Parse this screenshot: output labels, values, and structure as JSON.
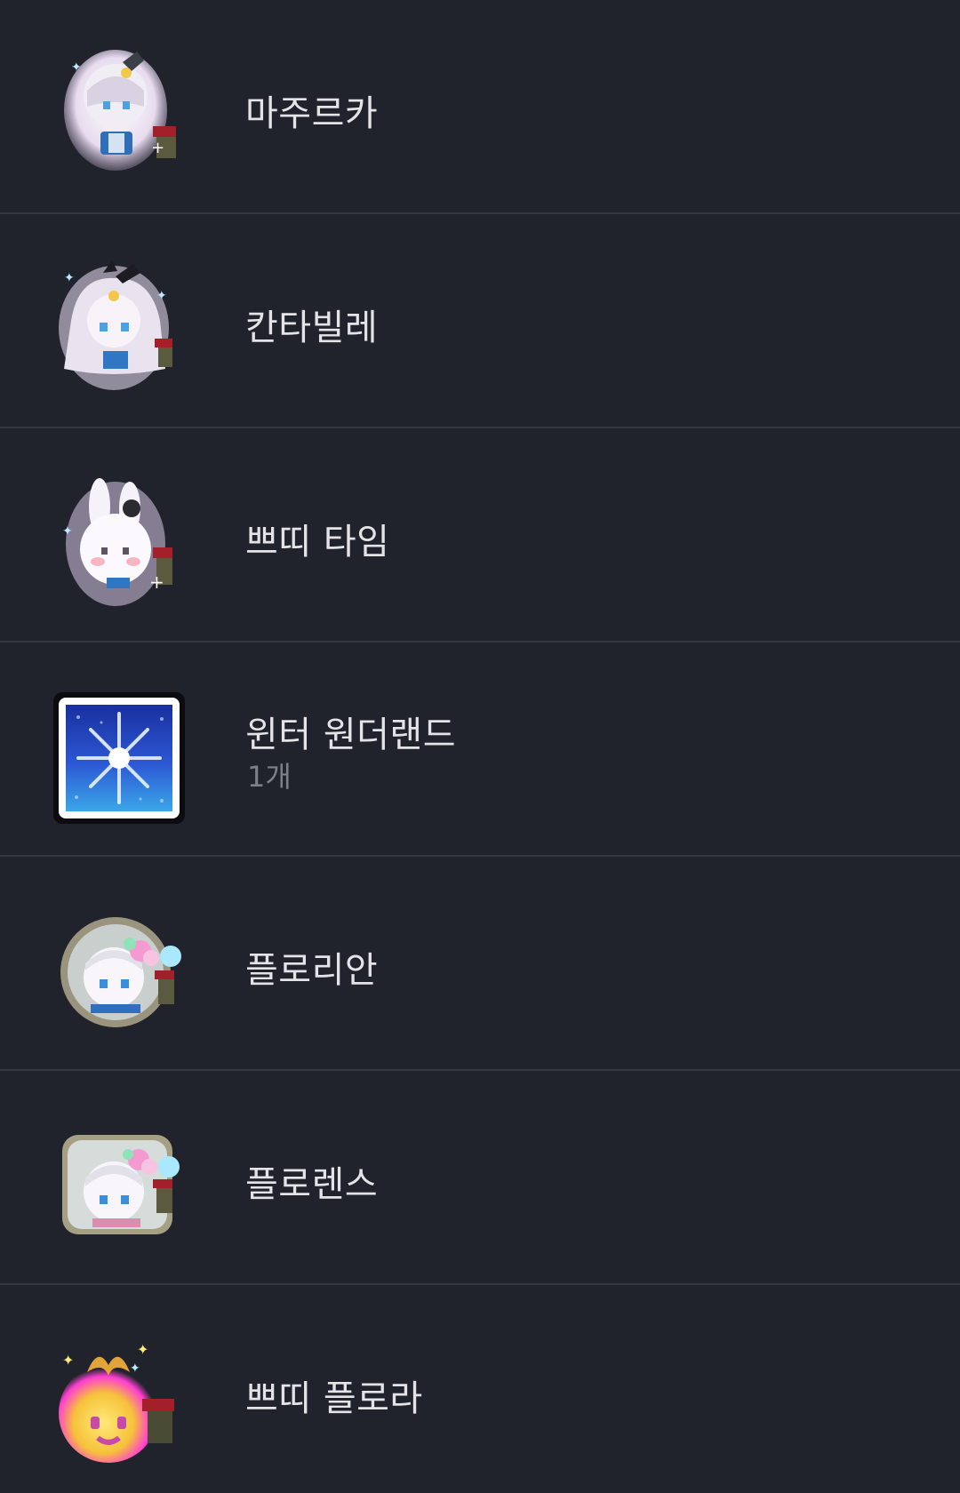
{
  "items": [
    {
      "name": "마주르카",
      "count": "",
      "icon": "chibi-character-icon"
    },
    {
      "name": "칸타빌레",
      "count": "",
      "icon": "chibi-character-icon"
    },
    {
      "name": "쁘띠 타임",
      "count": "",
      "icon": "bunny-character-icon"
    },
    {
      "name": "윈터 원더랜드",
      "count": "1개",
      "icon": "snowflake-tile-icon"
    },
    {
      "name": "플로리안",
      "count": "",
      "icon": "flower-chibi-icon"
    },
    {
      "name": "플로렌스",
      "count": "",
      "icon": "flower-chibi-icon"
    },
    {
      "name": "쁘띠 플로라",
      "count": "",
      "icon": "glowing-spirit-icon"
    }
  ],
  "colors": {
    "background": "#20232b",
    "divider": "#343844",
    "text": "#e3e3e8",
    "subtext": "#7d808a"
  }
}
